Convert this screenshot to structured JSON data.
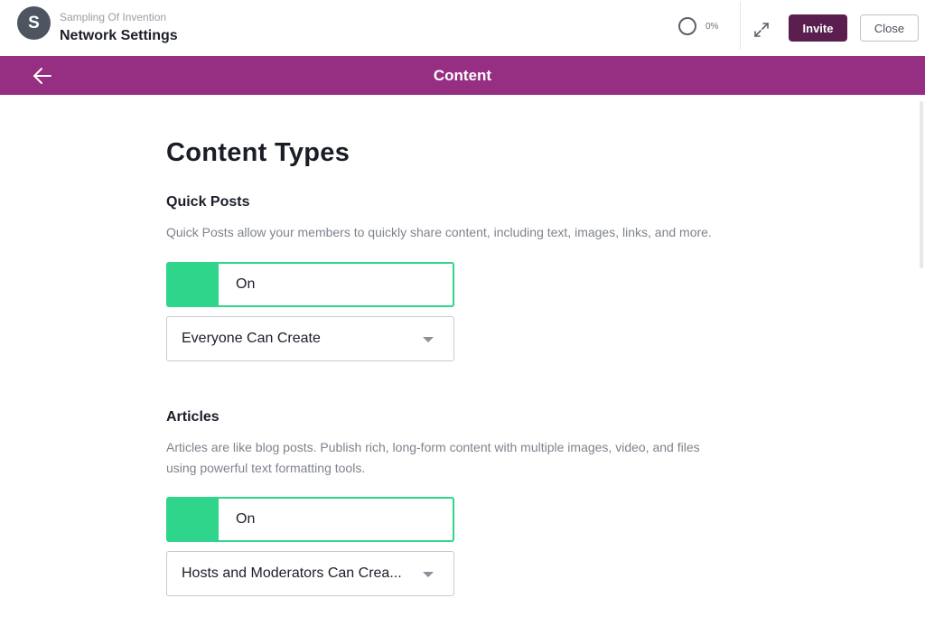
{
  "header": {
    "avatar_letter": "S",
    "network_name": "Sampling Of Invention",
    "page_title": "Network Settings",
    "progress_percent": 0,
    "progress_label": "0%",
    "invite_label": "Invite",
    "close_label": "Close"
  },
  "section": {
    "title": "Content"
  },
  "main": {
    "heading": "Content Types",
    "quick_posts": {
      "title": "Quick Posts",
      "description": "Quick Posts allow your members to quickly share content, including text, images, links, and more.",
      "toggle_label": "On",
      "permission": "Everyone Can Create"
    },
    "articles": {
      "title": "Articles",
      "description_line1": "Articles are like blog posts. Publish rich, long-form content with multiple images, video, and files",
      "description_line2": "using powerful text formatting tools.",
      "toggle_label": "On",
      "permission": "Hosts and Moderators Can Crea..."
    }
  },
  "colors": {
    "brand_header": "#962e82",
    "invite_button": "#5a1f4e",
    "toggle_on": "#2ed58a"
  }
}
